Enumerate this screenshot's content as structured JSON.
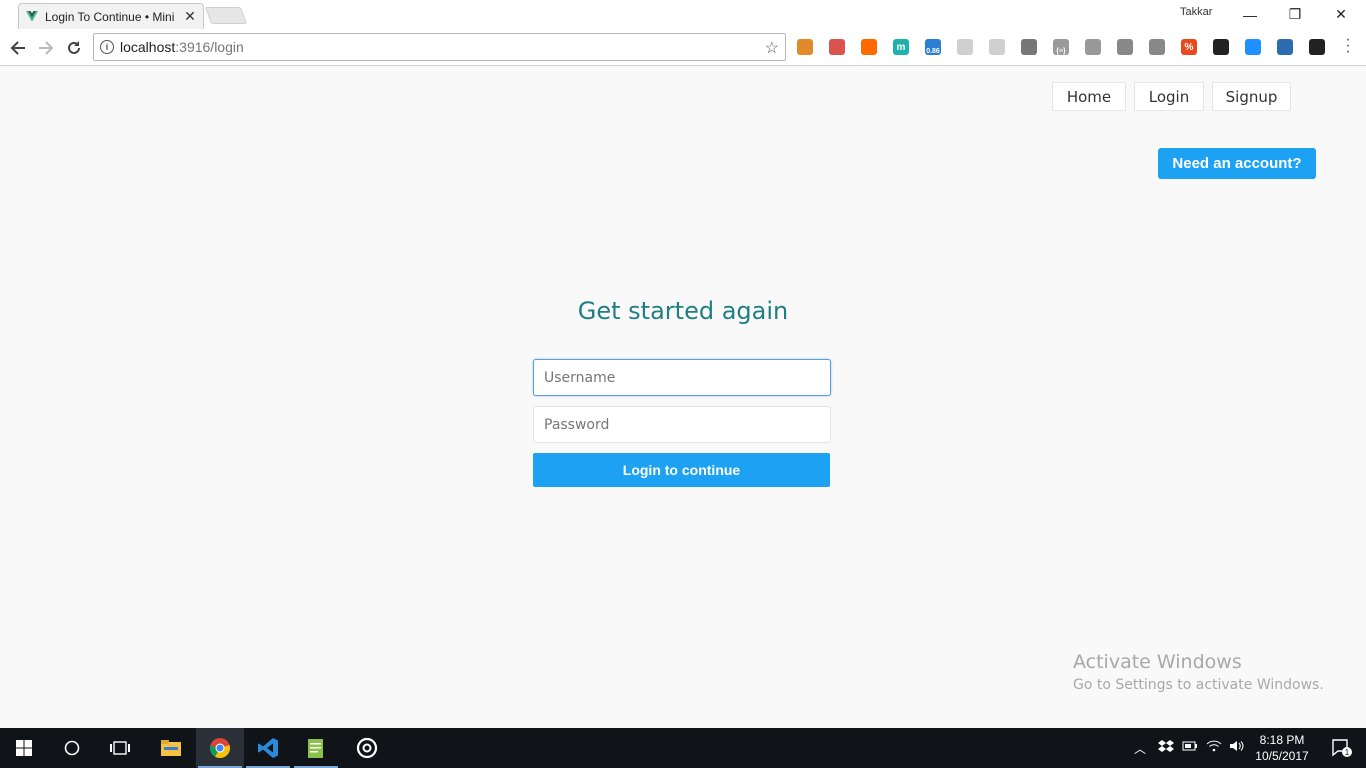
{
  "browser": {
    "tab_title": "Login To Continue • Mini",
    "tab_close": "✕",
    "profile_name": "Takkar",
    "url_host": "localhost",
    "url_path": ":3916/login",
    "window_controls": {
      "minimize": "—",
      "restore": "❐",
      "close": "✕"
    },
    "extensions": [
      {
        "name": "ext-1",
        "label": "",
        "color": "#e08a2c"
      },
      {
        "name": "ext-2",
        "label": "",
        "color": "#d9534f"
      },
      {
        "name": "ext-3",
        "label": "",
        "color": "#ff6a00"
      },
      {
        "name": "ext-4",
        "label": "m",
        "color": "#20b2aa"
      },
      {
        "name": "ext-5",
        "label": "0.86",
        "color": "#2d7dd2"
      },
      {
        "name": "ext-6",
        "label": "",
        "color": "#cfcfcf"
      },
      {
        "name": "ext-7",
        "label": "",
        "color": "#cfcfcf"
      },
      {
        "name": "ext-8",
        "label": "",
        "color": "#777777"
      },
      {
        "name": "ext-9",
        "label": "{≡}",
        "color": "#999999"
      },
      {
        "name": "ext-10",
        "label": "",
        "color": "#999999"
      },
      {
        "name": "ext-11",
        "label": "",
        "color": "#888888"
      },
      {
        "name": "ext-12",
        "label": "",
        "color": "#888888"
      },
      {
        "name": "ext-13",
        "label": "%",
        "color": "#e8491d"
      },
      {
        "name": "ext-14",
        "label": "",
        "color": "#222222"
      },
      {
        "name": "ext-15",
        "label": "",
        "color": "#1e90ff"
      },
      {
        "name": "ext-16",
        "label": "",
        "color": "#2b6cb0"
      },
      {
        "name": "ext-17",
        "label": "",
        "color": "#222222"
      }
    ]
  },
  "nav": {
    "home": "Home",
    "login": "Login",
    "signup": "Signup"
  },
  "cta": {
    "need_account": "Need an account?"
  },
  "form": {
    "heading": "Get started again",
    "username_placeholder": "Username",
    "password_placeholder": "Password",
    "submit": "Login to continue"
  },
  "watermark": {
    "title": "Activate Windows",
    "subtitle": "Go to Settings to activate Windows."
  },
  "taskbar": {
    "time": "8:18 PM",
    "date": "10/5/2017",
    "notification_count": "1"
  },
  "colors": {
    "accent": "#1da1f2",
    "heading": "#1f7f82"
  }
}
